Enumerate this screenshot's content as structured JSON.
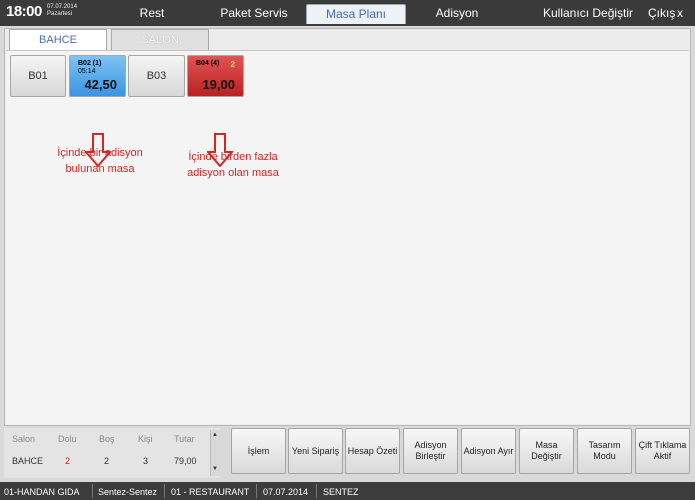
{
  "clock": {
    "time": "18:00",
    "date": "07.07.2014",
    "day": "Pazartesi"
  },
  "nav": {
    "tabs": [
      {
        "label": "Rest",
        "active": false
      },
      {
        "label": "Paket Servis",
        "active": false
      },
      {
        "label": "Masa Planı",
        "active": true
      },
      {
        "label": "Adisyon",
        "active": false
      }
    ],
    "user_switch": "Kullanıcı Değiştir",
    "logout": "Çıkış",
    "close": "x"
  },
  "areas": [
    {
      "label": "BAHCE",
      "active": true
    },
    {
      "label": "SALON",
      "active": false
    }
  ],
  "tables": [
    {
      "label": "B01",
      "state": "empty"
    },
    {
      "label": "B02 (1)",
      "time": "05:14",
      "amount": "42,50",
      "state": "single"
    },
    {
      "label": "B03",
      "state": "empty"
    },
    {
      "label": "B04 (4)",
      "count": "2",
      "amount": "19,00",
      "state": "multi"
    }
  ],
  "notes": {
    "single": [
      "İçinde bir adisyon",
      "bulunan masa"
    ],
    "multi": [
      "İçinde birden fazla",
      "adisyon olan masa"
    ]
  },
  "stats": {
    "headers": [
      "Salon",
      "Dolu",
      "Boş",
      "Kişi",
      "Tutar"
    ],
    "rows": [
      [
        "BAHCE",
        "2",
        "2",
        "3",
        "79,00"
      ]
    ]
  },
  "actions": [
    [
      "İşlem"
    ],
    [
      "Yeni Sipariş"
    ],
    [
      "Hesap Özeti"
    ],
    [
      "Adisyon",
      "Birleştir"
    ],
    [
      "Adisyon Ayır"
    ],
    [
      "Masa",
      "Değiştir"
    ],
    [
      "Tasarım",
      "Modu"
    ],
    [
      "Çift Tıklama",
      "Aktif"
    ]
  ],
  "status": [
    "01-HANDAN GIDA",
    "Sentez-Sentez",
    "01 - RESTAURANT",
    "07.07.2014",
    "SENTEZ"
  ],
  "colors": {
    "alert": "#d52626",
    "single_table": "#3b94e0",
    "multi_table": "#b92121",
    "active_tab": "#3d6bb3"
  }
}
